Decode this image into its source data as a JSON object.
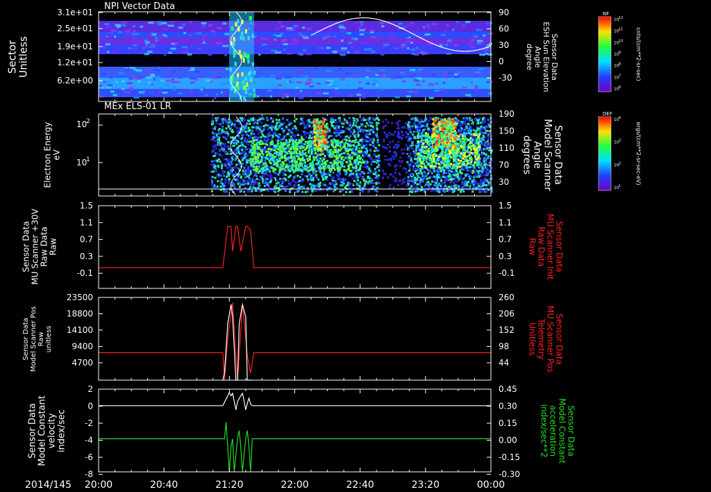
{
  "colors": {
    "axis": "#ffffff",
    "red": "#ff2020",
    "green": "#20e020",
    "white": "#ffffff",
    "background": "#000000"
  },
  "chart_data": [
    {
      "type": "heatmap",
      "title": "NPI Vector Data",
      "ylabel": [
        "Sector",
        "Unitless"
      ],
      "yticks": [
        "3.1e+01",
        "2.5e+01",
        "1.9e+01",
        "1.2e+01",
        "6.2e+00"
      ],
      "right_ylabel": [
        "Sensor Data",
        "ESH Sun Elevation",
        "Angle",
        "degree"
      ],
      "right_yticks": [
        90,
        60,
        30,
        0,
        -30
      ],
      "right_ylim": [
        -60,
        90
      ],
      "overlay_line": {
        "color": "#ffffff",
        "x": [
          "23:35",
          "23:40",
          "23:50",
          "00:00"
        ],
        "y": [
          38,
          72,
          55,
          32
        ]
      },
      "colorbar": {
        "label": "NF",
        "units": "cnts/(cm**2-sr-sec)",
        "ticks": [
          "10^12",
          "10^11",
          "10^10",
          "10^9",
          "10^8",
          "10^7",
          "10^6"
        ]
      }
    },
    {
      "type": "heatmap",
      "title": "MEx ELS-01 LR",
      "ylabel": [
        "Electron Energy",
        "eV"
      ],
      "yticks": [
        "10^2",
        "10^1"
      ],
      "right_ylabel": [
        "Sensor Data",
        "Model Scanner",
        "Angle",
        "degrees"
      ],
      "right_yticks": [
        190,
        150,
        110,
        70,
        30
      ],
      "right_ylim": [
        0,
        190
      ],
      "colorbar": {
        "label": "DEF",
        "units": "ergs/(cm**2-sr-sec-eV)",
        "ticks": [
          "10^4",
          "10^3",
          "10^2",
          "10^1"
        ]
      }
    },
    {
      "type": "line",
      "ylabel": [
        "Sensor Data",
        "MU Scanner +30V",
        "Raw Data",
        "Raw"
      ],
      "yticks": [
        1.5,
        1.1,
        0.7,
        0.3,
        -0.1
      ],
      "ylim": [
        -0.5,
        1.5
      ],
      "right_ylabel": [
        "Sensor Data",
        "MU Scanner Init",
        "Raw Data",
        "Raw"
      ],
      "right_yticks": [
        1.5,
        1.1,
        0.7,
        0.3,
        -0.1
      ],
      "series": [
        {
          "color": "#ff2020",
          "x": [
            "20:00",
            "21:16",
            "21:19",
            "21:21",
            "21:22",
            "21:24",
            "21:25",
            "21:27",
            "21:30",
            "21:31",
            "21:33",
            "21:35",
            "00:00"
          ],
          "y": [
            0,
            0,
            1,
            1,
            0.4,
            1,
            1,
            0.4,
            1,
            1,
            0.9,
            0,
            0
          ]
        }
      ]
    },
    {
      "type": "line",
      "ylabel": [
        "Sensor Data",
        "Model Scanner Pos",
        "Raw",
        "unitless"
      ],
      "yticks": [
        23500,
        18800,
        14100,
        9400,
        4700
      ],
      "ylim": [
        0,
        23500
      ],
      "right_ylabel": [
        "Sensor Data",
        "MU Scanner Pos",
        "Telemetry",
        "Unitless"
      ],
      "right_yticks": [
        260,
        206,
        152,
        98,
        44
      ],
      "series": [
        {
          "color": "#ff2020",
          "x": [
            "20:00",
            "21:16",
            "21:17",
            "21:19",
            "21:22",
            "21:25",
            "21:27",
            "21:28",
            "21:31",
            "21:33",
            "21:35",
            "00:00"
          ],
          "y": [
            7800,
            7800,
            0,
            12000,
            22000,
            0,
            14000,
            22000,
            7000,
            2000,
            7800,
            7800
          ]
        },
        {
          "color": "#ffffff",
          "x": [
            "21:16",
            "21:17",
            "21:19",
            "21:21",
            "21:22",
            "21:24",
            "21:25",
            "21:26",
            "21:28",
            "21:30",
            "21:31",
            "21:33",
            "21:34"
          ],
          "y": [
            0,
            2000,
            16000,
            21500,
            18000,
            0,
            0,
            16000,
            21500,
            18000,
            0,
            0,
            0
          ]
        }
      ]
    },
    {
      "type": "line",
      "ylabel": [
        "Sensor Data",
        "Model Constant",
        "velocity",
        "index/sec"
      ],
      "yticks": [
        2,
        0,
        -2,
        -4,
        -6,
        -8
      ],
      "ylim": [
        -8,
        2
      ],
      "right_ylabel": [
        "Sensor Data",
        "Model Constant",
        "acceleration",
        "index/sec**2"
      ],
      "right_yticks": [
        "0.45",
        "0.30",
        "0.15",
        "0.00",
        "-0.15",
        "-0.30"
      ],
      "right_ylim": [
        -0.3,
        0.45
      ],
      "series": [
        {
          "color": "#ffffff",
          "x": [
            "20:00",
            "21:16",
            "21:18",
            "21:20",
            "21:21",
            "21:22",
            "21:23",
            "21:24",
            "21:25",
            "21:27",
            "21:28",
            "21:29",
            "21:30",
            "21:31",
            "21:32",
            "21:33",
            "21:34",
            "00:00"
          ],
          "y": [
            0,
            0,
            0.8,
            1.6,
            1.2,
            1.5,
            0.5,
            -0.5,
            0.5,
            1.2,
            1.5,
            0.6,
            -0.5,
            0.3,
            0.9,
            0.2,
            0,
            0
          ]
        },
        {
          "color": "#20e020",
          "x": [
            "20:00",
            "21:17",
            "21:18",
            "21:19",
            "21:20",
            "21:21",
            "21:22",
            "21:23",
            "21:24",
            "21:25",
            "21:26",
            "21:27",
            "21:28",
            "21:29",
            "21:30",
            "21:31",
            "21:32",
            "21:33",
            "21:34",
            "00:00"
          ],
          "y": [
            -4,
            -4,
            -2,
            -5,
            -8,
            -5,
            -4,
            -8,
            -6,
            -4,
            -3,
            -5,
            -8,
            -6,
            -4,
            -3,
            -5,
            -8,
            -4,
            -4
          ]
        }
      ]
    }
  ],
  "xaxis": {
    "date_label": "2014/145",
    "ticks": [
      "20:00",
      "20:40",
      "21:20",
      "22:00",
      "22:40",
      "23:20",
      "00:00"
    ]
  }
}
